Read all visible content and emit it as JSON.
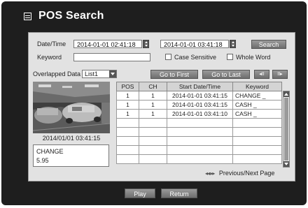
{
  "window": {
    "title": "POS Search"
  },
  "search": {
    "datetime_label": "Date/Time",
    "start_datetime": "2014-01-01  02:41:18",
    "end_datetime": "2014-01-01  03:41:18",
    "search_label": "Search",
    "keyword_label": "Keyword",
    "keyword_value": "",
    "case_sensitive_label": "Case Sensitive",
    "whole_word_label": "Whole Word"
  },
  "overlap": {
    "label": "Overlapped Data",
    "selected": "List1"
  },
  "nav": {
    "go_first_label": "Go to First",
    "go_last_label": "Go to Last",
    "prev_glyph": "◂II",
    "next_glyph": "II▸"
  },
  "preview": {
    "timestamp": "2014/01/01  03:41:15",
    "info_line1": "CHANGE",
    "info_line2": "5.95"
  },
  "table": {
    "headers": [
      "POS",
      "CH",
      "Start Date/Time",
      "Keyword"
    ],
    "rows": [
      [
        "1",
        "1",
        "2014-01-01 03:41:15",
        "CHANGE _"
      ],
      [
        "1",
        "1",
        "2014-01-01 03:41:15",
        "CASH _"
      ],
      [
        "1",
        "1",
        "2014-01-01 03:41:10",
        "CASH _"
      ],
      [
        "",
        "",
        "",
        ""
      ],
      [
        "",
        "",
        "",
        ""
      ],
      [
        "",
        "",
        "",
        ""
      ],
      [
        "",
        "",
        "",
        ""
      ],
      [
        "",
        "",
        "",
        ""
      ]
    ]
  },
  "pager": {
    "label": "Previous/Next Page",
    "glyph": "◂◂ ▸▸"
  },
  "footer": {
    "play_label": "Play",
    "return_label": "Return"
  },
  "colors": {
    "window_bg": "#1e1e1e",
    "panel_bg": "#e2e2e2",
    "button": "#7a7a7a"
  },
  "icons": {
    "title": "list-icon"
  }
}
